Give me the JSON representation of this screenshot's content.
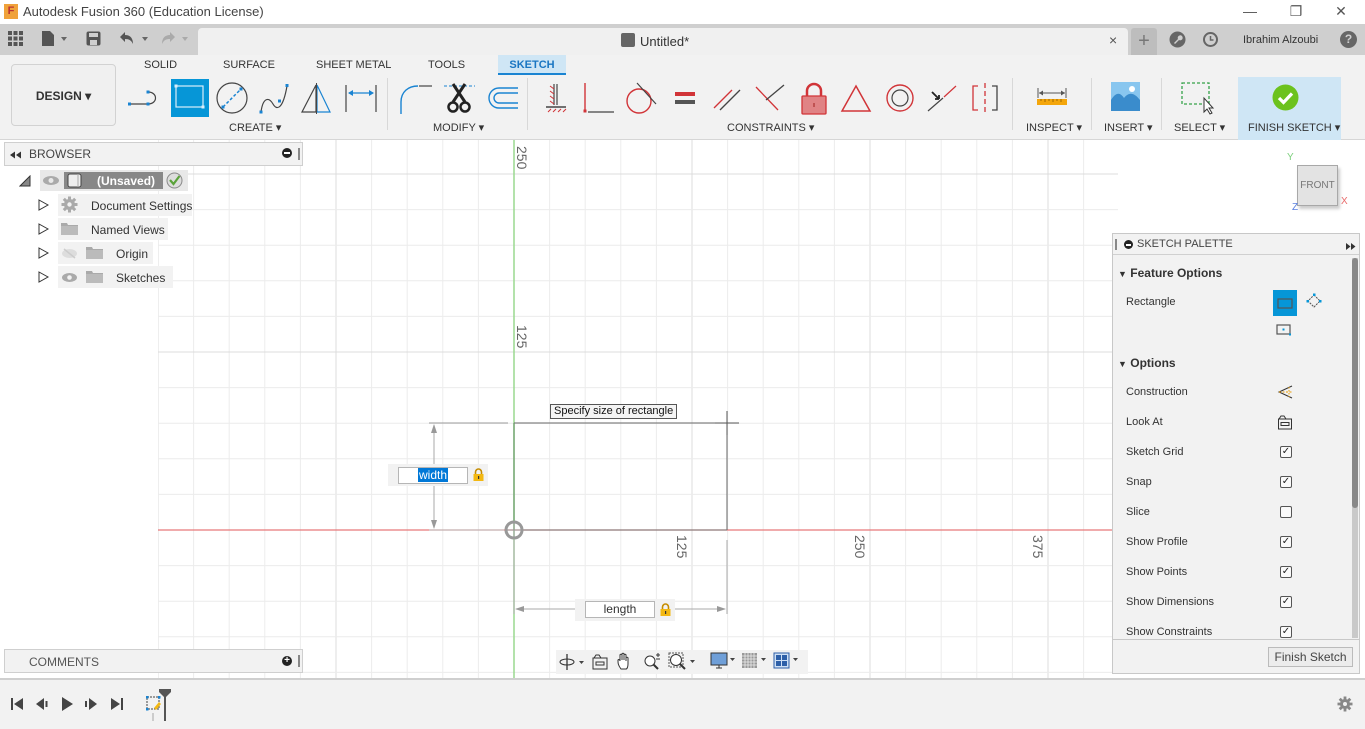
{
  "window": {
    "title": "Autodesk Fusion 360 (Education License)",
    "logo_letter": "F",
    "minimize": "—",
    "restore": "❐",
    "close": "✕"
  },
  "quick_access": {
    "apps_icon": "grid-icon",
    "file_icon": "file-icon",
    "save_icon": "save-icon",
    "undo_icon": "undo-icon",
    "redo_icon": "redo-icon"
  },
  "document_tab": {
    "title": "Untitled*",
    "close": "×",
    "new_tab": "+"
  },
  "user": {
    "name": "Ibrahim Alzoubi",
    "help": "?"
  },
  "workspace": {
    "label": "DESIGN ▾"
  },
  "ribbon_tabs": [
    {
      "label": "SOLID",
      "active": false
    },
    {
      "label": "SURFACE",
      "active": false
    },
    {
      "label": "SHEET METAL",
      "active": false
    },
    {
      "label": "TOOLS",
      "active": false
    },
    {
      "label": "SKETCH",
      "active": true
    }
  ],
  "ribbon_groups": {
    "create": "CREATE ▾",
    "modify": "MODIFY ▾",
    "constraints": "CONSTRAINTS ▾",
    "inspect": "INSPECT ▾",
    "insert": "INSERT ▾",
    "select": "SELECT ▾",
    "finish_sketch": "FINISH SKETCH ▾"
  },
  "create_tools": [
    "line",
    "rectangle",
    "circle",
    "spline",
    "mirror",
    "sketch-dimension"
  ],
  "modify_tools": [
    "fillet",
    "trim",
    "offset"
  ],
  "constraint_tools": [
    "fix",
    "coincident",
    "tangent",
    "equal",
    "parallel",
    "perpendicular",
    "lock",
    "midpoint",
    "concentric",
    "collinear",
    "symmetry"
  ],
  "browser": {
    "title": "BROWSER",
    "root": "(Unsaved)",
    "items": [
      {
        "label": "Document Settings",
        "icon": "gear-icon"
      },
      {
        "label": "Named Views",
        "icon": "folder-icon"
      },
      {
        "label": "Origin",
        "icon": "folder-icon",
        "hidden": true
      },
      {
        "label": "Sketches",
        "icon": "folder-icon"
      }
    ]
  },
  "comments": {
    "title": "COMMENTS"
  },
  "viewcube": {
    "face": "FRONT",
    "x": "X",
    "y": "Y",
    "z": "Z"
  },
  "canvas": {
    "tooltip": "Specify size of rectangle",
    "width_input": "width",
    "length_input": "length",
    "axis_labels": {
      "vertical": [
        "250",
        "125"
      ],
      "horizontal": [
        "125",
        "250",
        "375"
      ]
    }
  },
  "sketch_palette": {
    "title": "SKETCH PALETTE",
    "feature_options": "Feature Options",
    "rectangle_label": "Rectangle",
    "options": "Options",
    "rows": [
      {
        "label": "Construction",
        "type": "icon"
      },
      {
        "label": "Look At",
        "type": "icon"
      },
      {
        "label": "Sketch Grid",
        "type": "checkbox",
        "checked": true
      },
      {
        "label": "Snap",
        "type": "checkbox",
        "checked": true
      },
      {
        "label": "Slice",
        "type": "checkbox",
        "checked": false
      },
      {
        "label": "Show Profile",
        "type": "checkbox",
        "checked": true
      },
      {
        "label": "Show Points",
        "type": "checkbox",
        "checked": true
      },
      {
        "label": "Show Dimensions",
        "type": "checkbox",
        "checked": true
      },
      {
        "label": "Show Constraints",
        "type": "checkbox",
        "checked": true
      }
    ],
    "finish_button": "Finish Sketch"
  },
  "colors": {
    "accent": "#0696d7",
    "sketch_tab_bg": "#cfe6f5",
    "x_axis": "#e8797a",
    "y_axis": "#9ad98f",
    "constraint_red": "#d13438",
    "finish_green": "#6cc21d"
  }
}
